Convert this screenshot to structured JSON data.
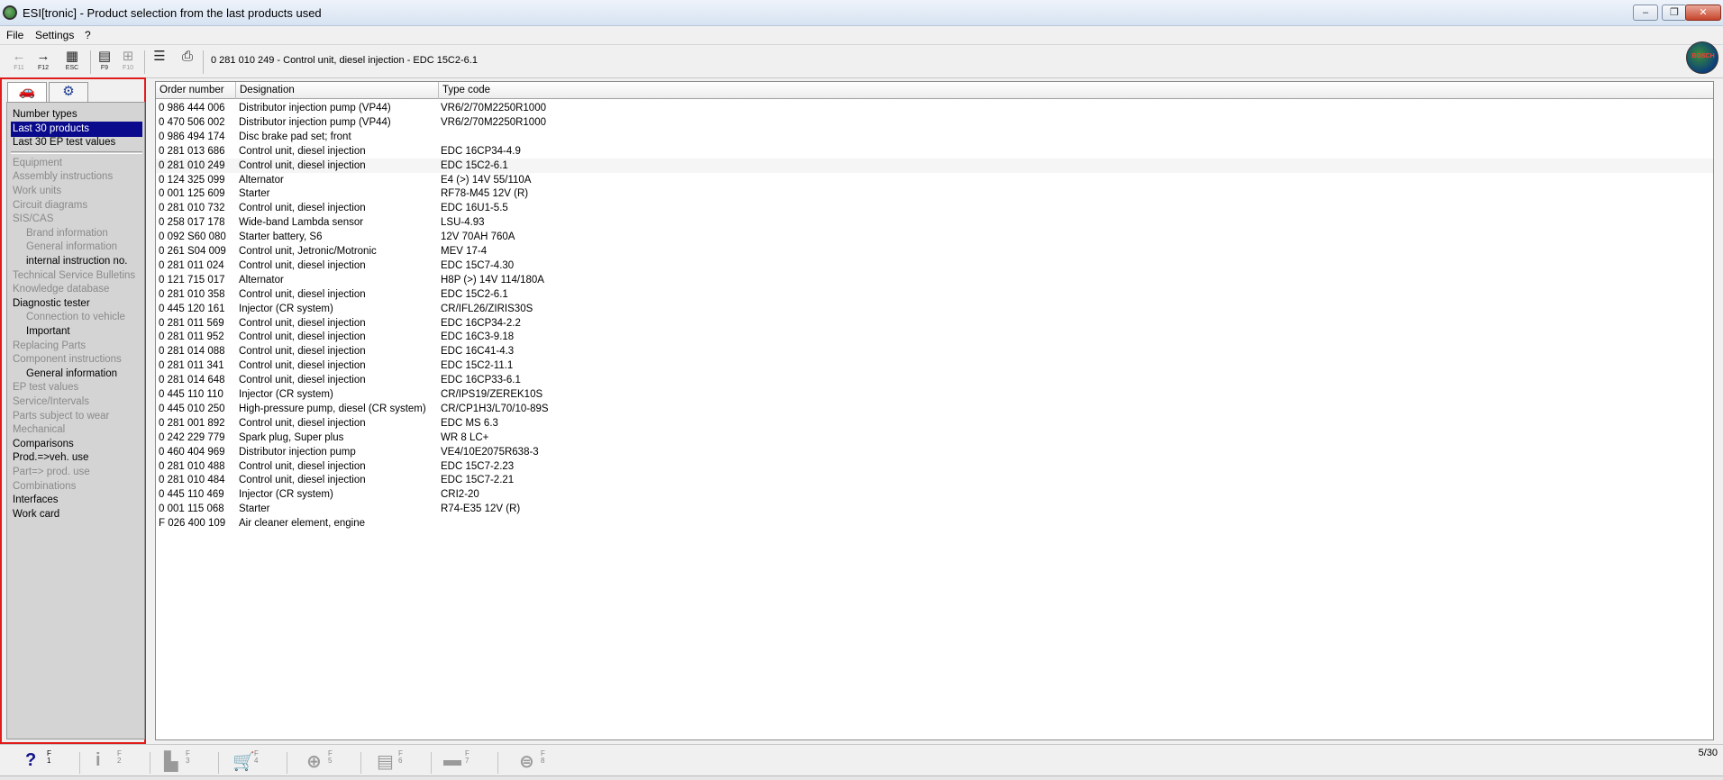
{
  "window": {
    "title": "ESI[tronic] - Product selection from the last products used",
    "minimize": "‒",
    "maximize": "❐",
    "close": "✕"
  },
  "menu": [
    "File",
    "Settings",
    "?"
  ],
  "toolbar": {
    "buttons": [
      {
        "name": "back-icon",
        "glyph": "←",
        "key": "F11",
        "enabled": false
      },
      {
        "name": "forward-icon",
        "glyph": "→",
        "key": "F12",
        "enabled": true
      },
      {
        "name": "escape-icon",
        "glyph": "▦",
        "key": "ESC",
        "enabled": true
      },
      {
        "name": "document-icon",
        "glyph": "▤",
        "key": "F9",
        "enabled": true
      },
      {
        "name": "network-icon",
        "glyph": "⊞",
        "key": "F10",
        "enabled": false
      },
      {
        "name": "list-icon",
        "glyph": "☰",
        "key": "",
        "enabled": true
      },
      {
        "name": "print-icon",
        "glyph": "⎙",
        "key": "",
        "enabled": true
      }
    ],
    "breadcrumb": "0 281 010 249 - Control unit, diesel injection - EDC 15C2-6.1",
    "logo": "BOSCH"
  },
  "left_panel": {
    "tabs": [
      {
        "name": "car-tab",
        "glyph": "🚗"
      },
      {
        "name": "engine-tab",
        "glyph": "⚙"
      }
    ],
    "groups": [
      [
        {
          "label": "Number types",
          "state": "normal",
          "indent": false
        },
        {
          "label": "Last 30 products",
          "state": "selected",
          "indent": false
        },
        {
          "label": "Last 30 EP test values",
          "state": "normal",
          "indent": false
        }
      ],
      [
        {
          "label": "Equipment",
          "state": "disabled",
          "indent": false
        },
        {
          "label": "Assembly instructions",
          "state": "disabled",
          "indent": false
        },
        {
          "label": "Work units",
          "state": "disabled",
          "indent": false
        },
        {
          "label": "Circuit diagrams",
          "state": "disabled",
          "indent": false
        },
        {
          "label": "SIS/CAS",
          "state": "disabled",
          "indent": false
        },
        {
          "label": "Brand information",
          "state": "disabled",
          "indent": true
        },
        {
          "label": "General information",
          "state": "disabled",
          "indent": true
        },
        {
          "label": "internal instruction no.",
          "state": "normal",
          "indent": true
        },
        {
          "label": "Technical Service Bulletins",
          "state": "disabled",
          "indent": false
        },
        {
          "label": "Knowledge database",
          "state": "disabled",
          "indent": false
        },
        {
          "label": "Diagnostic tester",
          "state": "normal",
          "indent": false
        },
        {
          "label": "Connection to vehicle",
          "state": "disabled",
          "indent": true
        },
        {
          "label": "Important",
          "state": "normal",
          "indent": true
        },
        {
          "label": "Replacing Parts",
          "state": "disabled",
          "indent": false
        },
        {
          "label": "Component instructions",
          "state": "disabled",
          "indent": false
        },
        {
          "label": "General information",
          "state": "normal",
          "indent": true
        },
        {
          "label": "EP test values",
          "state": "disabled",
          "indent": false
        },
        {
          "label": "Service/Intervals",
          "state": "disabled",
          "indent": false
        },
        {
          "label": "Parts subject to wear",
          "state": "disabled",
          "indent": false
        },
        {
          "label": "Mechanical",
          "state": "disabled",
          "indent": false
        },
        {
          "label": "Comparisons",
          "state": "normal",
          "indent": false
        },
        {
          "label": "Prod.=>veh. use",
          "state": "normal",
          "indent": false
        },
        {
          "label": "Part=> prod. use",
          "state": "disabled",
          "indent": false
        },
        {
          "label": "Combinations",
          "state": "disabled",
          "indent": false
        },
        {
          "label": "Interfaces",
          "state": "normal",
          "indent": false
        },
        {
          "label": "Work card",
          "state": "normal",
          "indent": false
        }
      ]
    ]
  },
  "table": {
    "columns": [
      "Order number",
      "Designation",
      "Type code"
    ],
    "rows": [
      [
        "0 986 444 006",
        "Distributor injection pump (VP44)",
        "VR6/2/70M2250R1000"
      ],
      [
        "0 470 506 002",
        "Distributor injection pump (VP44)",
        "VR6/2/70M2250R1000"
      ],
      [
        "0 986 494 174",
        "Disc brake pad set; front",
        ""
      ],
      [
        "0 281 013 686",
        "Control unit, diesel injection",
        "EDC 16CP34-4.9"
      ],
      [
        "0 281 010 249",
        "Control unit, diesel injection",
        "EDC 15C2-6.1"
      ],
      [
        "0 124 325 099",
        "Alternator",
        "E4 (>) 14V 55/110A"
      ],
      [
        "0 001 125 609",
        "Starter",
        "RF78-M45 12V (R)"
      ],
      [
        "0 281 010 732",
        "Control unit, diesel injection",
        "EDC 16U1-5.5"
      ],
      [
        "0 258 017 178",
        "Wide-band Lambda sensor",
        "LSU-4.93"
      ],
      [
        "0 092 S60 080",
        "Starter battery, S6",
        "12V 70AH 760A"
      ],
      [
        "0 261 S04 009",
        "Control unit, Jetronic/Motronic",
        "MEV 17-4"
      ],
      [
        "0 281 011 024",
        "Control unit, diesel injection",
        "EDC 15C7-4.30"
      ],
      [
        "0 121 715 017",
        "Alternator",
        "H8P (>) 14V 114/180A"
      ],
      [
        "0 281 010 358",
        "Control unit, diesel injection",
        "EDC 15C2-6.1"
      ],
      [
        "0 445 120 161",
        "Injector (CR system)",
        "CR/IFL26/ZIRIS30S"
      ],
      [
        "0 281 011 569",
        "Control unit, diesel injection",
        "EDC 16CP34-2.2"
      ],
      [
        "0 281 011 952",
        "Control unit, diesel injection",
        "EDC 16C3-9.18"
      ],
      [
        "0 281 014 088",
        "Control unit, diesel injection",
        "EDC 16C41-4.3"
      ],
      [
        "0 281 011 341",
        "Control unit, diesel injection",
        "EDC 15C2-11.1"
      ],
      [
        "0 281 014 648",
        "Control unit, diesel injection",
        "EDC 16CP33-6.1"
      ],
      [
        "0 445 110 110",
        "Injector (CR system)",
        "CR/IPS19/ZEREK10S"
      ],
      [
        "0 445 010 250",
        "High-pressure pump, diesel (CR system)",
        "CR/CP1H3/L70/10-89S"
      ],
      [
        "0 281 001 892",
        "Control unit, diesel injection",
        "EDC MS 6.3"
      ],
      [
        "0 242 229 779",
        "Spark plug, Super plus",
        "WR 8 LC+"
      ],
      [
        "0 460 404 969",
        "Distributor injection pump",
        "VE4/10E2075R638-3"
      ],
      [
        "0 281 010 488",
        "Control unit, diesel injection",
        "EDC 15C7-2.23"
      ],
      [
        "0 281 010 484",
        "Control unit, diesel injection",
        "EDC 15C7-2.21"
      ],
      [
        "0 445 110 469",
        "Injector (CR system)",
        "CRI2-20"
      ],
      [
        "0 001 115 068",
        "Starter",
        "R74-E35 12V (R)"
      ],
      [
        "F 026 400 109",
        "Air cleaner element, engine",
        ""
      ]
    ]
  },
  "footer": {
    "buttons": [
      {
        "name": "help-icon",
        "glyph": "?",
        "key": "F\n1",
        "enabled": true
      },
      {
        "name": "info-icon",
        "glyph": "i",
        "key": "F\n2",
        "enabled": false
      },
      {
        "name": "building-icon",
        "glyph": "▙",
        "key": "F\n3",
        "enabled": false
      },
      {
        "name": "cart-icon",
        "glyph": "🛒",
        "key": "F\n4",
        "enabled": false
      },
      {
        "name": "zoom-icon",
        "glyph": "⊕",
        "key": "F\n5",
        "enabled": false
      },
      {
        "name": "archive-icon",
        "glyph": "▤",
        "key": "F\n6",
        "enabled": false
      },
      {
        "name": "vehicle-icon",
        "glyph": "▬",
        "key": "F\n7",
        "enabled": false
      },
      {
        "name": "wheel-icon",
        "glyph": "⊜",
        "key": "F\n8",
        "enabled": false
      }
    ],
    "page_indicator": "5/30"
  }
}
